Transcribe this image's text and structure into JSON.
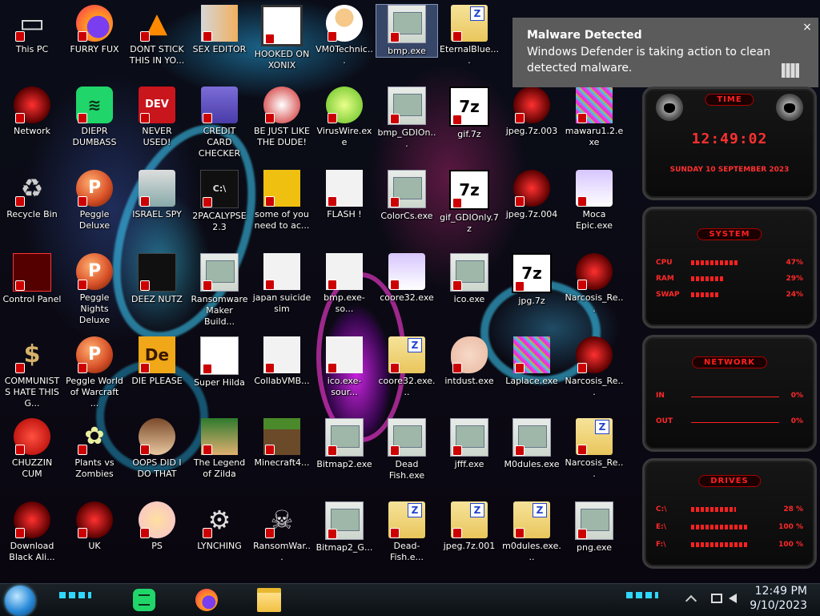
{
  "desktop": {
    "icons": [
      {
        "id": "this-pc",
        "label": "This PC",
        "icon": "computer-icon"
      },
      {
        "id": "furry-fux",
        "label": "FURRY FUX",
        "icon": "firefox-icon"
      },
      {
        "id": "dont-stick",
        "label": "DONT STICK THIS IN YO...",
        "icon": "vlc-cone-icon"
      },
      {
        "id": "sex-editor",
        "label": "SEX EDITOR",
        "icon": "hxd-editor-icon"
      },
      {
        "id": "hooked-on-xonix",
        "label": "HOOKED ON XONIX",
        "icon": "xonix-game-icon"
      },
      {
        "id": "vm0technic",
        "label": "VM0Technic...",
        "icon": "doctor-person-icon"
      },
      {
        "id": "bmp-exe",
        "label": "bmp.exe",
        "icon": "picture-icon"
      },
      {
        "id": "eternalblue",
        "label": "EternalBlue....",
        "icon": "zip-folder-icon"
      },
      {
        "id": "network",
        "label": "Network",
        "icon": "network-icon"
      },
      {
        "id": "diepr",
        "label": "DIEPR DUMBASS",
        "icon": "spotify-icon"
      },
      {
        "id": "never-used",
        "label": "NEVER USED!",
        "icon": "dev-cpp-icon"
      },
      {
        "id": "credit-card-checker",
        "label": "CREDIT CARD CHECKER",
        "icon": "credit-card-icon"
      },
      {
        "id": "be-just-like",
        "label": "BE JUST LIKE THE DUDE!",
        "icon": "santa-icon"
      },
      {
        "id": "viruswire",
        "label": "VirusWire.exe",
        "icon": "lime-icon"
      },
      {
        "id": "bmp-gdionly",
        "label": "bmp_GDIOn...",
        "icon": "picture-icon"
      },
      {
        "id": "gif-7z",
        "label": "gif.7z",
        "icon": "7z-archive-icon"
      },
      {
        "id": "jpeg-7z-003",
        "label": "jpeg.7z.003",
        "icon": "alienware-file-icon"
      },
      {
        "id": "mawaru",
        "label": "mawaru1.2.exe",
        "icon": "noise-icon"
      },
      {
        "id": "recycle-bin",
        "label": "Recycle Bin",
        "icon": "recycle-bin-icon"
      },
      {
        "id": "peggle-deluxe",
        "label": "Peggle Deluxe",
        "icon": "peggle-icon"
      },
      {
        "id": "israel-spy",
        "label": "ISRAEL SPY",
        "icon": "network-card-icon"
      },
      {
        "id": "2pacalypse",
        "label": "2PACALYPSE 2.3",
        "icon": "console-icon"
      },
      {
        "id": "some-of-you",
        "label": "some of you need to ac...",
        "icon": "beaver-icon"
      },
      {
        "id": "flash",
        "label": "FLASH !",
        "icon": "flash-file-icon"
      },
      {
        "id": "colorcs",
        "label": "ColorCs.exe",
        "icon": "app-window-icon"
      },
      {
        "id": "gif-gdionly",
        "label": "gif_GDIOnly.7z",
        "icon": "7z-archive-icon"
      },
      {
        "id": "jpeg-7z-004",
        "label": "jpeg.7z.004",
        "icon": "alienware-file-icon"
      },
      {
        "id": "moca-epic",
        "label": "Moca Epic.exe",
        "icon": "anime-girl-icon"
      },
      {
        "id": "control-panel",
        "label": "Control Panel",
        "icon": "control-panel-icon"
      },
      {
        "id": "peggle-nights",
        "label": "Peggle Nights Deluxe",
        "icon": "peggle-icon"
      },
      {
        "id": "deez-nutz",
        "label": "DEEZ NUTZ",
        "icon": "windows-stack-icon"
      },
      {
        "id": "ransomware-maker",
        "label": "Ransomware Maker Build...",
        "icon": "app-window-icon"
      },
      {
        "id": "japan-suicide-sim",
        "label": "japan suicide sim",
        "icon": "installer-icon"
      },
      {
        "id": "bmp-exe-source",
        "label": "bmp.exe-so...",
        "icon": "flash-file-icon"
      },
      {
        "id": "coore32-exe",
        "label": "coore32.exe",
        "icon": "anime-girl-icon"
      },
      {
        "id": "ico-exe",
        "label": "ico.exe",
        "icon": "app-window-icon"
      },
      {
        "id": "jpg-7z",
        "label": "jpg.7z",
        "icon": "7z-archive-icon"
      },
      {
        "id": "narcosis-re-1",
        "label": "Narcosis_Re...",
        "icon": "alienware-file-icon"
      },
      {
        "id": "communists",
        "label": "COMMUNISTS HATE THIS G...",
        "icon": "money-bag-icon"
      },
      {
        "id": "peggle-world",
        "label": "Peggle World of Warcraft ...",
        "icon": "peggle-icon"
      },
      {
        "id": "die-please",
        "label": "DIE PLEASE",
        "icon": "de-app-icon"
      },
      {
        "id": "super-hilda",
        "label": "Super Hilda",
        "icon": "pixel-dog-icon"
      },
      {
        "id": "collabvmb",
        "label": "CollabVMB...",
        "icon": "monitor-icon"
      },
      {
        "id": "ico-exe-source",
        "label": "ico.exe-sour...",
        "icon": "flash-file-icon"
      },
      {
        "id": "coore32-zip",
        "label": "coore32.exe...",
        "icon": "zip-folder-icon"
      },
      {
        "id": "intdust",
        "label": "intdust.exe",
        "icon": "paint-palette-icon"
      },
      {
        "id": "laplace",
        "label": "Laplace.exe",
        "icon": "noise-icon"
      },
      {
        "id": "narcosis-re-2",
        "label": "Narcosis_Re...",
        "icon": "alienware-file-icon"
      },
      {
        "id": "chuzzin-cum",
        "label": "CHUZZIN CUM",
        "icon": "chuzzle-icon"
      },
      {
        "id": "plants-vs-zombies",
        "label": "Plants vs Zombies",
        "icon": "flower-icon"
      },
      {
        "id": "oops-did",
        "label": "OOPS DID I DO THAT",
        "icon": "portrait-icon"
      },
      {
        "id": "legend-of-zilda",
        "label": "The Legend of Zilda",
        "icon": "pixel-hero-icon"
      },
      {
        "id": "minecraft4",
        "label": "Minecraft4...",
        "icon": "minecraft-block-icon"
      },
      {
        "id": "bitmap2",
        "label": "Bitmap2.exe",
        "icon": "app-window-icon"
      },
      {
        "id": "dead-fish",
        "label": "Dead Fish.exe",
        "icon": "app-window-icon"
      },
      {
        "id": "jfff",
        "label": "jfff.exe",
        "icon": "app-window-icon"
      },
      {
        "id": "m0dules",
        "label": "M0dules.exe",
        "icon": "app-window-icon"
      },
      {
        "id": "narcosis-re-3",
        "label": "Narcosis_Re...",
        "icon": "zip-folder-icon"
      },
      {
        "id": "download-black",
        "label": "Download Black Ali...",
        "icon": "alienware-orb-icon"
      },
      {
        "id": "uk",
        "label": "UK",
        "icon": "alienware-orb-icon"
      },
      {
        "id": "ps",
        "label": "PS",
        "icon": "star-girl-icon"
      },
      {
        "id": "lynching",
        "label": "LYNCHING",
        "icon": "gear-icon"
      },
      {
        "id": "ransomwar",
        "label": "RansomWar...",
        "icon": "skull-icon"
      },
      {
        "id": "bitmap2-g",
        "label": "Bitmap2_G...",
        "icon": "app-window-icon"
      },
      {
        "id": "dead-fish-zip",
        "label": "Dead-Fish.e...",
        "icon": "zip-folder-icon"
      },
      {
        "id": "jpeg-7z-001",
        "label": "jpeg.7z.001",
        "icon": "zip-folder-icon"
      },
      {
        "id": "m0dules-zip",
        "label": "m0dules.exe...",
        "icon": "zip-folder-icon"
      },
      {
        "id": "png-exe",
        "label": "png.exe",
        "icon": "app-window-icon"
      }
    ]
  },
  "notification": {
    "title": "Malware Detected",
    "message": "Windows Defender is taking action to clean detected malware.",
    "close_glyph": "×"
  },
  "gadget": {
    "time_title": "TIME",
    "time": "12:49:02",
    "date": "SUNDAY 10 SEPTEMBER 2023",
    "system_title": "SYSTEM",
    "system": [
      {
        "name": "CPU",
        "value": "47%"
      },
      {
        "name": "RAM",
        "value": "29%"
      },
      {
        "name": "SWAP",
        "value": "24%"
      }
    ],
    "network_title": "NETWORK",
    "network": [
      {
        "name": "IN",
        "value": "0%"
      },
      {
        "name": "OUT",
        "value": "0%"
      }
    ],
    "drives_title": "DRIVES",
    "drives": [
      {
        "name": "C:\\",
        "value": "28 %"
      },
      {
        "name": "E:\\",
        "value": "100 %"
      },
      {
        "name": "F:\\",
        "value": "100 %"
      }
    ]
  },
  "taskbar": {
    "apps": [
      "spotify-icon",
      "firefox-icon",
      "file-explorer-icon"
    ],
    "time": "12:49 PM",
    "date": "9/10/2023"
  },
  "colors": {
    "accent_red": "#ff2020",
    "taskbar_glow": "#2fd8ff",
    "toast_bg": "#5b5b5b"
  }
}
